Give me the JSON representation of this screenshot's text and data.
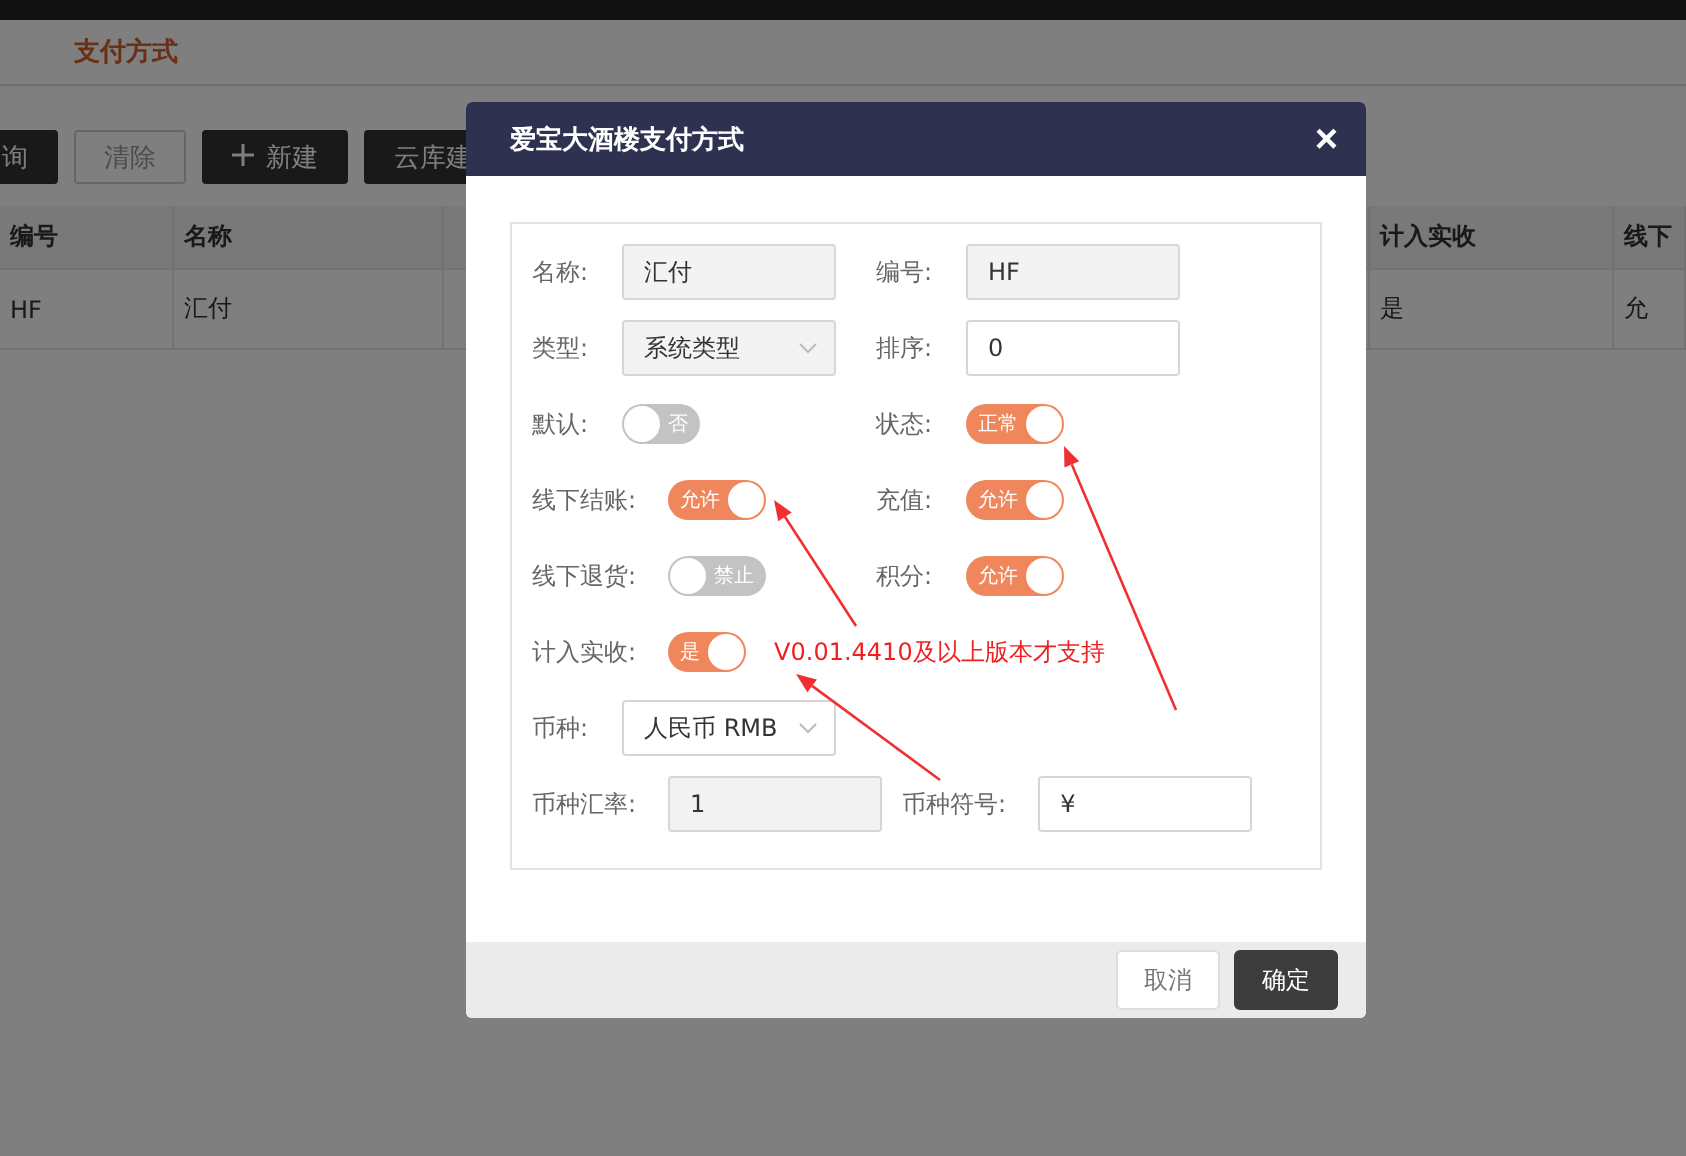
{
  "background": {
    "tab": "支付方式",
    "toolbar": [
      {
        "label": "询",
        "kind": "dark"
      },
      {
        "label": "清除",
        "kind": "plain"
      },
      {
        "label": "新建",
        "kind": "add"
      },
      {
        "label": "云库建",
        "kind": "dark"
      }
    ],
    "table": {
      "columns": [
        "编号",
        "名称",
        "",
        "计入实收",
        "线下"
      ],
      "rows": [
        [
          "HF",
          "汇付",
          "",
          "是",
          "允"
        ]
      ]
    }
  },
  "dialog": {
    "title": "爱宝大酒楼支付方式",
    "close": "×",
    "rows": [
      {
        "fields": [
          {
            "kind": "input",
            "label": "名称:",
            "value": "汇付",
            "disabled": true
          },
          {
            "kind": "input",
            "label": "编号:",
            "value": "HF",
            "disabled": true
          }
        ]
      },
      {
        "fields": [
          {
            "kind": "select",
            "label": "类型:",
            "value": "系统类型",
            "disabled": true
          },
          {
            "kind": "input",
            "label": "排序:",
            "value": "0",
            "disabled": false
          }
        ]
      },
      {
        "fields": [
          {
            "kind": "toggle",
            "label": "默认:",
            "text": "否",
            "on": false
          },
          {
            "kind": "toggle",
            "label": "状态:",
            "text": "正常",
            "on": true
          }
        ]
      },
      {
        "fields": [
          {
            "kind": "toggle",
            "label": "线下结账:",
            "text": "允许",
            "on": true
          },
          {
            "kind": "toggle",
            "label": "充值:",
            "text": "允许",
            "on": true
          }
        ]
      },
      {
        "fields": [
          {
            "kind": "toggle",
            "label": "线下退货:",
            "text": "禁止",
            "on": false
          },
          {
            "kind": "toggle",
            "label": "积分:",
            "text": "允许",
            "on": true
          }
        ]
      },
      {
        "fields": [
          {
            "kind": "toggle",
            "label": "计入实收:",
            "text": "是",
            "on": true
          },
          {
            "kind": "note",
            "text": "V0.01.4410及以上版本才支持"
          }
        ]
      },
      {
        "fields": [
          {
            "kind": "select",
            "label": "币种:",
            "value": "人民币 RMB",
            "disabled": false
          }
        ]
      },
      {
        "fields": [
          {
            "kind": "input",
            "label": "币种汇率:",
            "value": "1",
            "disabled": true
          },
          {
            "kind": "input",
            "label": "币种符号:",
            "value": "¥",
            "disabled": false
          }
        ]
      }
    ],
    "buttons": [
      {
        "label": "取消",
        "kind": "cancel"
      },
      {
        "label": "确定",
        "kind": "primary"
      }
    ]
  }
}
